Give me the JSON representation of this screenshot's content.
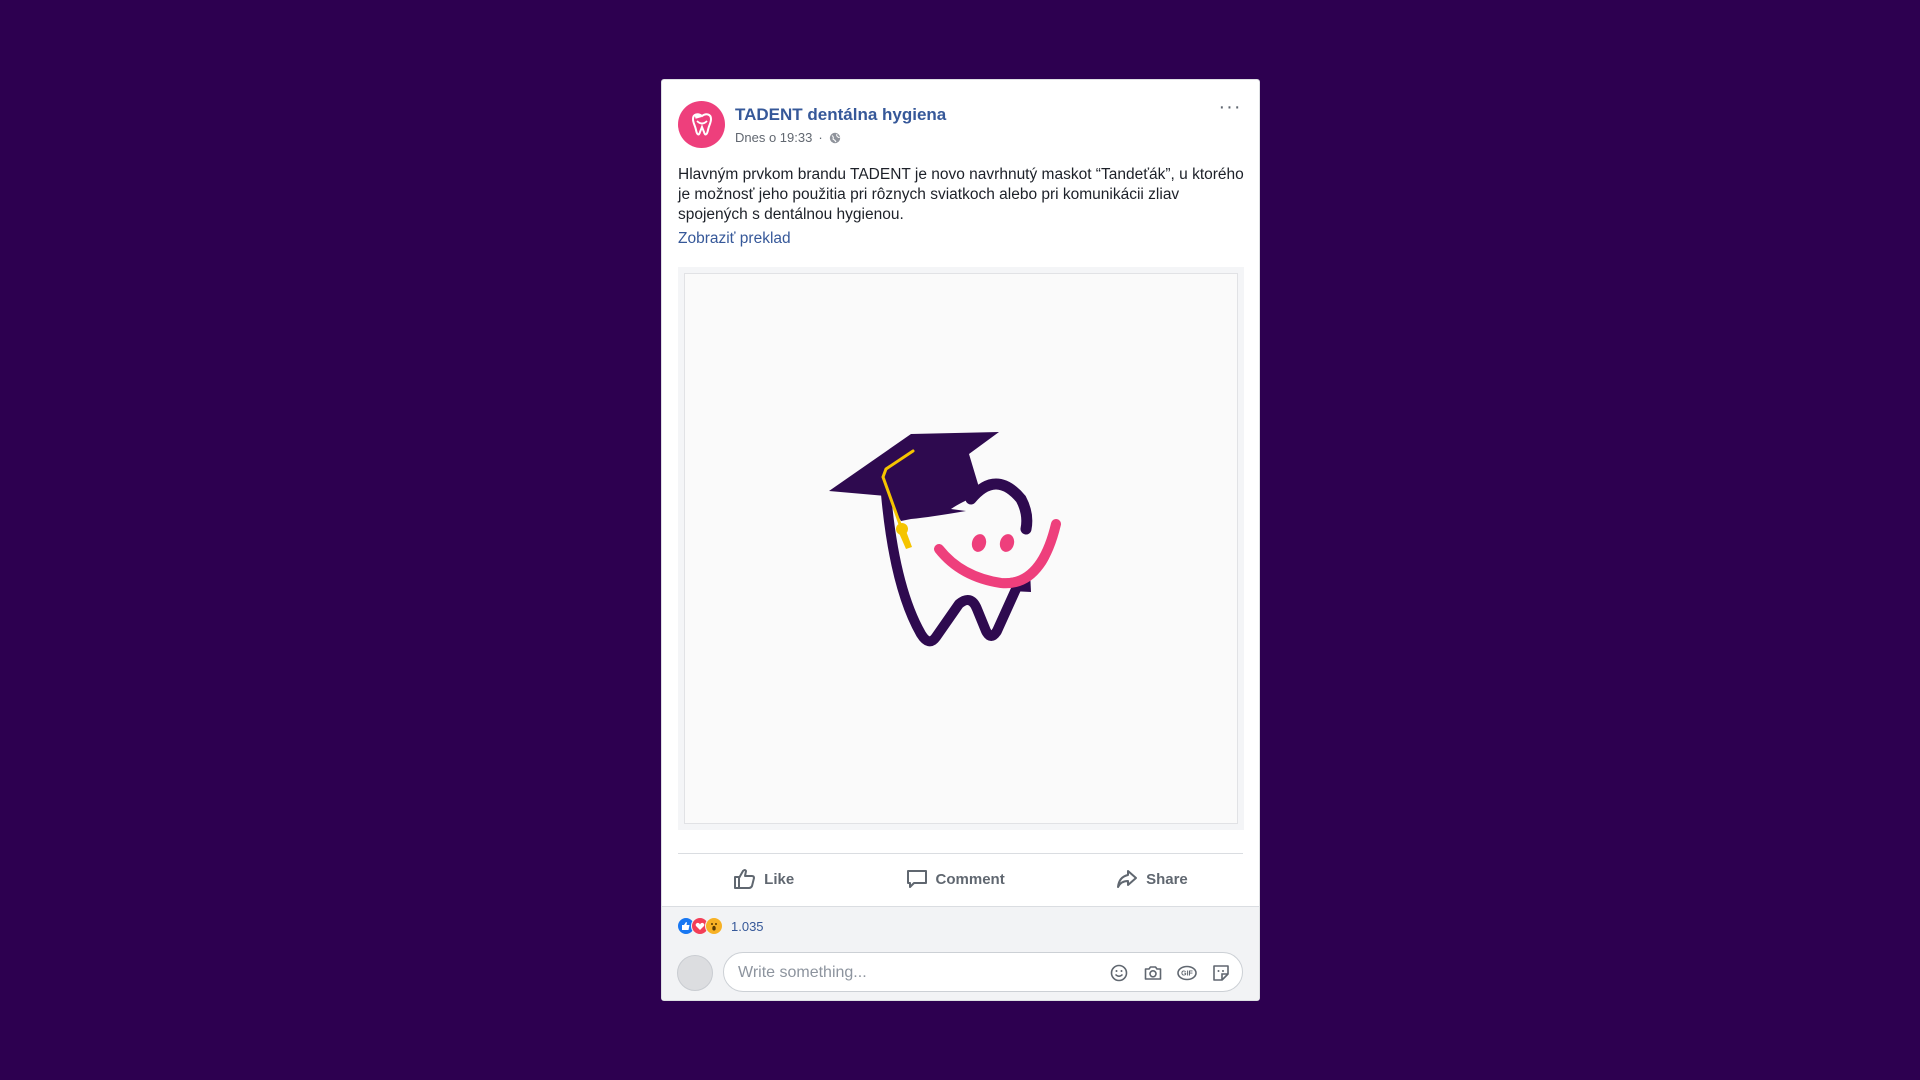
{
  "post": {
    "page_name": "TADENT dentálna hygiena",
    "timestamp": "Dnes o 19:33",
    "separator": "·",
    "audience_icon": "globe-icon",
    "more_label": "···",
    "text": "Hlavným prvkom brandu TADENT je novo navrhnutý maskot “Tandeťák”, u ktorého je možnosť jeho použitia pri rôznych sviatkoch alebo pri komunikácii zliav spojených s dentálnou hygienou.",
    "translate_link": "Zobraziť preklad"
  },
  "actions": {
    "like": "Like",
    "comment": "Comment",
    "share": "Share"
  },
  "reactions": {
    "icons": [
      "like-icon",
      "love-icon",
      "wow-icon"
    ],
    "count": "1.035"
  },
  "comment": {
    "placeholder": "Write something...",
    "tool_icons": [
      "emoji-icon",
      "camera-icon",
      "gif-icon",
      "sticker-icon"
    ]
  },
  "colors": {
    "background": "#2d0050",
    "brand_pink": "#ee3f7c",
    "mascot_purple": "#2e0a4f",
    "tassel_yellow": "#f5c400",
    "link_blue": "#365899"
  }
}
